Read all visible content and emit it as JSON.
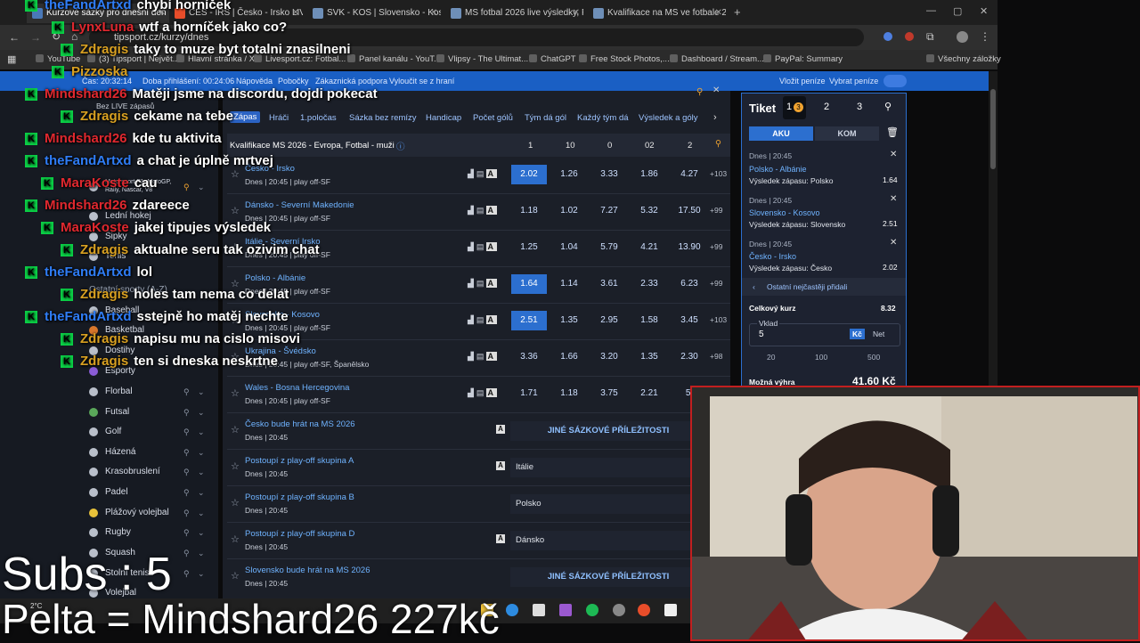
{
  "browser": {
    "tabs": [
      {
        "title": "Kurzové sázky pro dnešní den | ..."
      },
      {
        "title": "CES - IRS | Česko - Irsko LIVE 2..."
      },
      {
        "title": "SVK - KOS | Slovensko - Kosovo ..."
      },
      {
        "title": "MS fotbal 2026 live výsledky, Fo..."
      },
      {
        "title": "Kvalifikace na MS ve fotbale 20..."
      }
    ],
    "url": "tipsport.cz/kurzy/dnes",
    "bookmarks": [
      "YouTube",
      "(3) Tipsport | Největ...",
      "Hlavní stránka / X",
      "Livesport.cz: Fotbal...",
      "Panel kanálu - YouT...",
      "Vlipsy - The Ultimat...",
      "ChatGPT",
      "Free Stock Photos,...",
      "Dashboard / Stream...",
      "PayPal: Summary",
      "Všechny záložky"
    ]
  },
  "site_bar": {
    "time": "Čas: 20:32:14",
    "since_login": "Doba přihlášení: 00:24:06",
    "help": "Nápověda",
    "branches": "Pobočky",
    "support": "Zákaznická podpora",
    "exclude": "Vyloučit se z hraní",
    "deposit": "Vložit peníze",
    "withdraw": "Vybrat peníze"
  },
  "left_nav": {
    "no_live": "Bez LIVE zápasů",
    "items": [
      {
        "label": "Motorsport F1, MotoGP, Rally, Nascar, V8"
      },
      {
        "label": "Lední hokej"
      },
      {
        "label": "Šipky"
      },
      {
        "label": "Tenis"
      },
      {
        "label": "Ostatní sporty (A-Z)"
      },
      {
        "label": "Baseball"
      },
      {
        "label": "Basketbal"
      },
      {
        "label": "Dostihy"
      },
      {
        "label": "Esporty"
      },
      {
        "label": "Florbal"
      },
      {
        "label": "Futsal"
      },
      {
        "label": "Golf"
      },
      {
        "label": "Házená"
      },
      {
        "label": "Krasobruslení"
      },
      {
        "label": "Padel"
      },
      {
        "label": "Plážový volejbal"
      },
      {
        "label": "Rugby"
      },
      {
        "label": "Squash"
      },
      {
        "label": "Stolní tenis"
      },
      {
        "label": "Volejbal"
      }
    ]
  },
  "filters": [
    "Zápas",
    "Hráči",
    "1.poločas",
    "Sázka bez remízy",
    "Handicap",
    "Počet gólů",
    "Tým dá gól",
    "Každý tým dá",
    "Výsledek a góly"
  ],
  "league": {
    "title": "Kvalifikace MS 2026 - Evropa, Fotbal - muži",
    "cols": [
      "1",
      "10",
      "0",
      "02",
      "2"
    ]
  },
  "matches": [
    {
      "teams": "Česko - Irsko",
      "info": "Dnes | 20:45 | play off-SF",
      "odds": [
        "2.02",
        "1.26",
        "3.33",
        "1.86",
        "4.27"
      ],
      "more": "+103"
    },
    {
      "teams": "Dánsko - Severní Makedonie",
      "info": "Dnes | 20:45 | play off-SF",
      "odds": [
        "1.18",
        "1.02",
        "7.27",
        "5.32",
        "17.50"
      ],
      "more": "+99"
    },
    {
      "teams": "Itálie - Severní Irsko",
      "info": "Dnes | 20:45 | play off-SF",
      "odds": [
        "1.25",
        "1.04",
        "5.79",
        "4.21",
        "13.90"
      ],
      "more": "+99"
    },
    {
      "teams": "Polsko - Albánie",
      "info": "Dnes | 20:45 | play off-SF",
      "odds": [
        "1.64",
        "1.14",
        "3.61",
        "2.33",
        "6.23"
      ],
      "more": "+99"
    },
    {
      "teams": "Slovensko - Kosovo",
      "info": "Dnes | 20:45 | play off-SF",
      "odds": [
        "2.51",
        "1.35",
        "2.95",
        "1.58",
        "3.45"
      ],
      "more": "+103"
    },
    {
      "teams": "Ukrajina - Švédsko",
      "info": "Dnes | 20:45 | play off-SF, Španělsko",
      "odds": [
        "3.36",
        "1.66",
        "3.20",
        "1.35",
        "2.30"
      ],
      "more": "+98"
    },
    {
      "teams": "Wales - Bosna Hercegovina",
      "info": "Dnes | 20:45 | play off-SF",
      "odds": [
        "1.71",
        "1.18",
        "3.75",
        "2.21",
        "5."
      ],
      "more": ""
    }
  ],
  "specials": [
    {
      "title": "Česko bude hrát na MS 2026",
      "info": "Dnes | 20:45",
      "value": "JINÉ SÁZKOVÉ PŘÍLEŽITOSTI"
    },
    {
      "title": "Postoupí z play-off skupina A",
      "info": "Dnes | 20:45",
      "value": "Itálie"
    },
    {
      "title": "Postoupí z play-off skupina B",
      "info": "Dnes | 20:45",
      "value": "Polsko"
    },
    {
      "title": "Postoupí z play-off skupina D",
      "info": "Dnes | 20:45",
      "value": "Dánsko"
    },
    {
      "title": "Slovensko bude hrát na MS 2026",
      "info": "Dnes | 20:45",
      "value": "JINÉ SÁZKOVÉ PŘÍLEŽITOSTI"
    }
  ],
  "ticket": {
    "title": "Tiket",
    "tabs": [
      "1",
      "2",
      "3"
    ],
    "badge": "3",
    "mode_aku": "AKU",
    "mode_kom": "KOM",
    "bets": [
      {
        "time": "Dnes | 20:45",
        "match": "Polsko - Albánie",
        "pick": "Výsledek zápasu: Polsko",
        "odd": "1.64"
      },
      {
        "time": "Dnes | 20:45",
        "match": "Slovensko - Kosovo",
        "pick": "Výsledek zápasu: Slovensko",
        "odd": "2.51"
      },
      {
        "time": "Dnes | 20:45",
        "match": "Česko - Irsko",
        "pick": "Výsledek zápasu: Česko",
        "odd": "2.02"
      }
    ],
    "others": "Ostatní nejčastěji přidali",
    "total_label": "Celkový kurz",
    "total": "8.32",
    "stake_label": "Vklad",
    "stake": "5",
    "cur_kc": "Kč",
    "cur_net": "Net",
    "quick": [
      "20",
      "100",
      "500"
    ],
    "win_label": "Možná výhra",
    "win": "41.60 Kč"
  },
  "chat": [
    {
      "name": "theFandArtxd",
      "msg": "chybí horníček",
      "color": "#2f7df6"
    },
    {
      "name": "LynxLuna",
      "msg": "wtf a horníček jako co?",
      "color": "#e0282f"
    },
    {
      "name": "Zdragis",
      "msg": "taky to muze byt totalni znasilneni",
      "color": "#d8a021"
    },
    {
      "name": "Pizzoska",
      "msg": "",
      "color": "#d8a021"
    },
    {
      "name": "Mindshard26",
      "msg": "Matěji jsme na discordu, dojdi pokecat",
      "color": "#e0282f"
    },
    {
      "name": "Zdragis",
      "msg": "cekame na tebe",
      "color": "#d8a021"
    },
    {
      "name": "Mindshard26",
      "msg": "kde tu aktivita",
      "color": "#e0282f"
    },
    {
      "name": "theFandArtxd",
      "msg": "a chat je úplně mrtvej",
      "color": "#2f7df6"
    },
    {
      "name": "MaraKoste",
      "msg": "cau",
      "color": "#e0282f"
    },
    {
      "name": "Mindshard26",
      "msg": "zdareece",
      "color": "#e0282f"
    },
    {
      "name": "MaraKoste",
      "msg": "jakej tipujes výsledek",
      "color": "#e0282f"
    },
    {
      "name": "Zdragis",
      "msg": "aktualne seru tak ozivim chat",
      "color": "#d8a021"
    },
    {
      "name": "theFandArtxd",
      "msg": "lol",
      "color": "#2f7df6"
    },
    {
      "name": "Zdragis",
      "msg": "holes tam nema co delat",
      "color": "#d8a021"
    },
    {
      "name": "theFandArtxd",
      "msg": "sstejně ho matěj nechte",
      "color": "#2f7df6"
    },
    {
      "name": "Zdragis",
      "msg": "napisu mu na cislo misovi",
      "color": "#d8a021"
    },
    {
      "name": "Zdragis",
      "msg": "ten si dneska neskrtne",
      "color": "#d8a021"
    }
  ],
  "overlay": {
    "subs": "Subs : 5",
    "pelta": "Pelta = Mindshard26 227kč"
  },
  "taskbar": {
    "weather": "2°C"
  }
}
